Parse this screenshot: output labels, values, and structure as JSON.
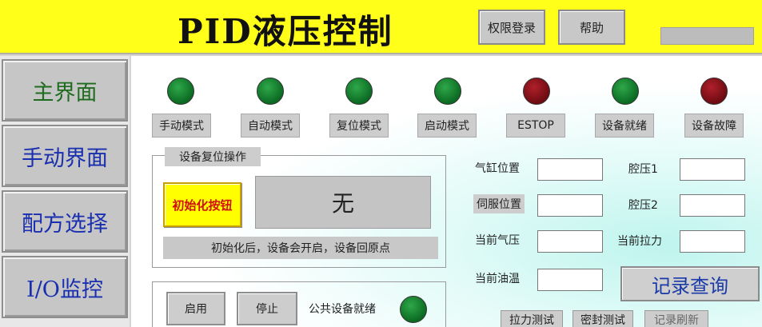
{
  "header": {
    "title": "PID液压控制",
    "login_label": "权限登录",
    "help_label": "帮助"
  },
  "sidebar": {
    "items": [
      {
        "label": "主界面",
        "active": true
      },
      {
        "label": "手动界面"
      },
      {
        "label": "配方选择"
      },
      {
        "label": "I/O监控"
      }
    ]
  },
  "indicators": [
    {
      "label": "手动模式",
      "color": "#0b6a22"
    },
    {
      "label": "自动模式",
      "color": "#0b6a22"
    },
    {
      "label": "复位模式",
      "color": "#0b6a22"
    },
    {
      "label": "启动模式",
      "color": "#0b6a22"
    },
    {
      "label": "ESTOP",
      "color": "#6e0b12"
    },
    {
      "label": "设备就绪",
      "color": "#0b6a22"
    },
    {
      "label": "设备故障",
      "color": "#6e0b12"
    }
  ],
  "reset_panel": {
    "title": "设备复位操作",
    "init_button": "初始化按钮",
    "status_value": "无",
    "note": "初始化后，设备会开启，设备回原点"
  },
  "control_panel": {
    "enable_label": "启用",
    "stop_label": "停止",
    "ready_label": "公共设备就绪"
  },
  "readouts": {
    "cylinder_position": "气缸位置",
    "servo_position": "伺服位置",
    "current_air_pressure": "当前气压",
    "current_oil_temp": "当前油温",
    "cavity_pressure_1": "腔压1",
    "cavity_pressure_2": "腔压2",
    "current_tension": "当前拉力"
  },
  "record_button": "记录查询",
  "tests": {
    "tension_test": "拉力测试",
    "seal_test": "密封测试",
    "third_partial": "记录刷新"
  },
  "colors": {
    "header_bg": "#ffff1a",
    "nav_text": "#1a2fb0",
    "nav_active_text": "#1f6b1f",
    "lamp_green": "#0b6a22",
    "lamp_red": "#6e0b12"
  }
}
